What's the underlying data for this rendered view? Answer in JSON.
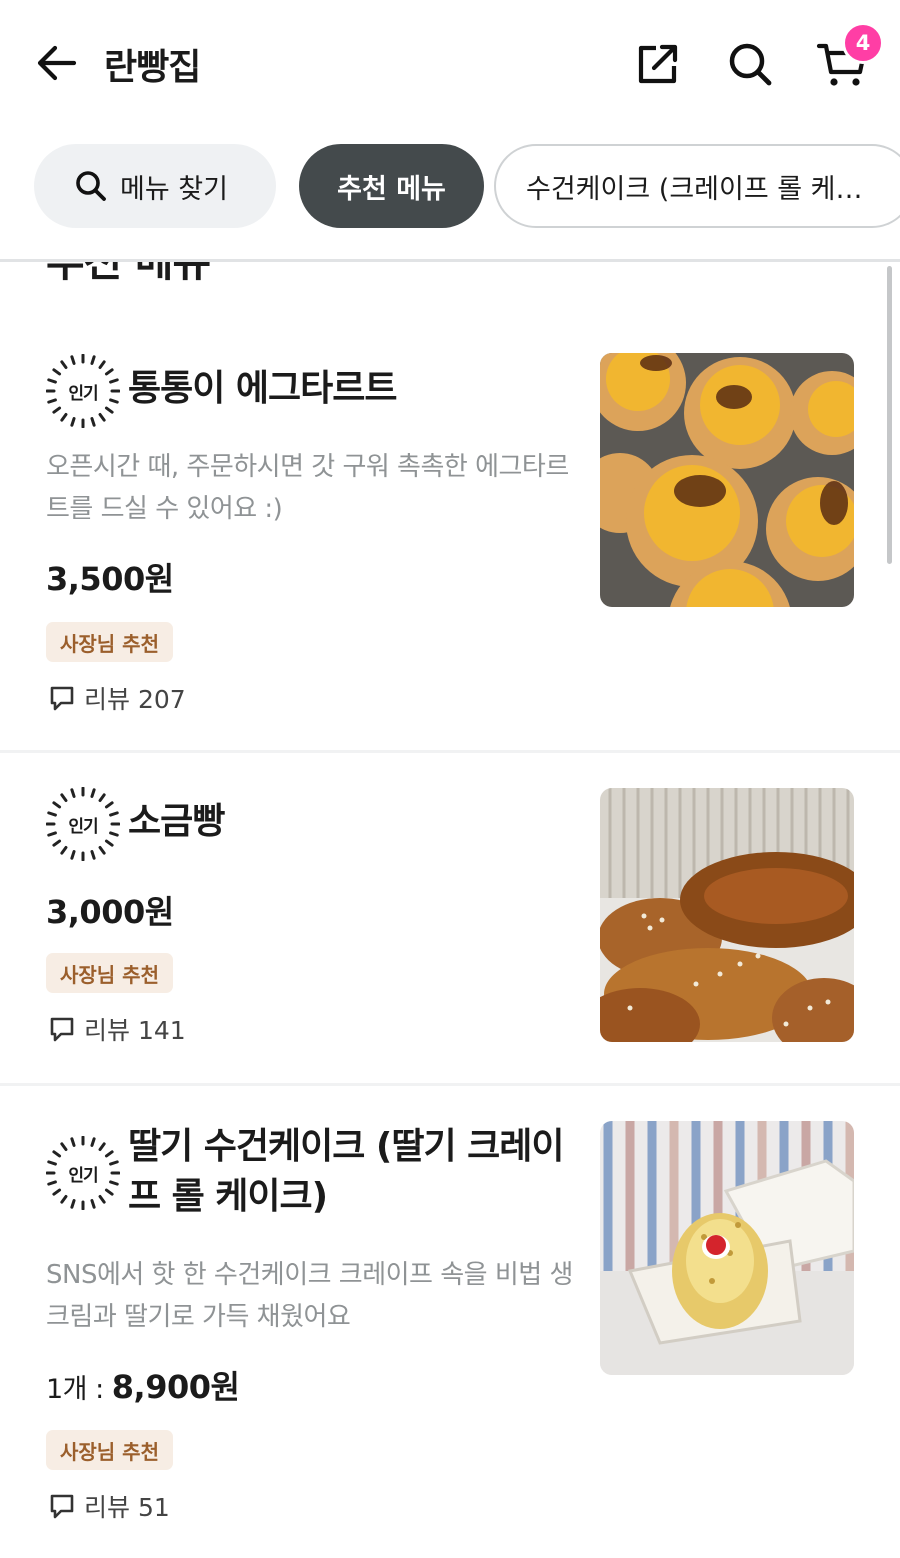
{
  "header": {
    "title": "란빵집",
    "cart_count": "4"
  },
  "chips": {
    "search_label": "메뉴 찾기",
    "recommended_label": "추천 메뉴",
    "cake_label": "수건케이크 (크레이프 롤 케이크)"
  },
  "section": {
    "title": "추천 메뉴"
  },
  "colors": {
    "accent_badge": "#ff3ea5",
    "chip_active": "#444a4c",
    "tag_bg": "#f7ede4",
    "tag_text": "#9b5f2c"
  },
  "items": [
    {
      "popular_label": "인기",
      "name": "통통이 에그타르트",
      "description": "오픈시간 때, 주문하시면 갓 구워 촉촉한 에그타르트를 드실 수 있어요 :)",
      "price": "3,500원",
      "tag": "사장님 추천",
      "review_label": "리뷰 207",
      "image": "egg-tart-photo"
    },
    {
      "popular_label": "인기",
      "name": "소금빵",
      "price": "3,000원",
      "tag": "사장님 추천",
      "review_label": "리뷰 141",
      "image": "salt-bread-photo"
    },
    {
      "popular_label": "인기",
      "name": "딸기 수건케이크 (딸기 크레이프 롤 케이크)",
      "description": "SNS에서 핫 한 수건케이크 크레이프 속을 비법 생크림과 딸기로 가득 채웠어요",
      "price_unit": "1개 : ",
      "price": "8,900원",
      "tag": "사장님 추천",
      "review_label": "리뷰 51",
      "image": "strawberry-towel-cake-photo"
    }
  ]
}
